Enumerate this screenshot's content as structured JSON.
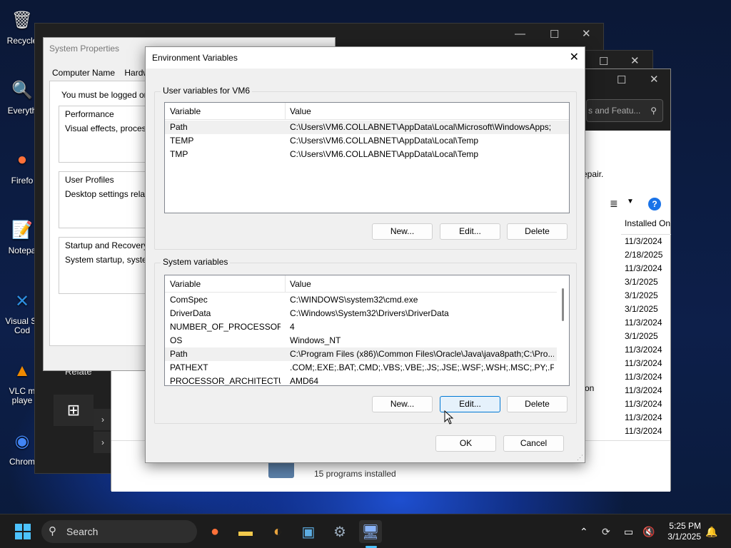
{
  "desktop": {
    "icons": [
      {
        "label": "Recycle",
        "icon": "recycle-bin-icon"
      },
      {
        "label": "Everyth",
        "icon": "search-tool-icon"
      },
      {
        "label": "Firefo",
        "icon": "firefox-icon"
      },
      {
        "label": "Notepa",
        "icon": "notepad-icon"
      },
      {
        "label": "Visual St\nCod",
        "icon": "vscode-icon"
      },
      {
        "label": "VLC m\nplaye",
        "icon": "vlc-icon"
      },
      {
        "label": "Chrom",
        "icon": "chrome-icon"
      }
    ]
  },
  "programs_features": {
    "search_placeholder": "s and Featu...",
    "repair_text": "epair.",
    "installed_on_header": "Installed On",
    "dates": [
      "11/3/2024",
      "2/18/2025",
      "11/3/2024",
      "3/1/2025",
      "3/1/2025",
      "3/1/2025",
      "11/3/2024",
      "3/1/2025",
      "11/3/2024",
      "11/3/2024",
      "11/3/2024",
      "11/3/2024",
      "11/3/2024",
      "11/3/2024",
      "11/3/2024"
    ],
    "on_text": "on",
    "footer_count": "15 programs installed",
    "relate_text": "Relate"
  },
  "system_properties": {
    "title": "System Properties",
    "tab_computer_name": "Computer Name",
    "tab_hardware": "Hardwa",
    "logged_on_text": "You must be logged on a",
    "performance_label": "Performance",
    "performance_text": "Visual effects, processo",
    "user_profiles_label": "User Profiles",
    "user_profiles_text": "Desktop settings related",
    "startup_label": "Startup and Recovery",
    "startup_text": "System startup, system f"
  },
  "env_dialog": {
    "title": "Environment Variables",
    "user_group_label": "User variables for VM6",
    "system_group_label": "System variables",
    "col_variable": "Variable",
    "col_value": "Value",
    "user_vars": [
      {
        "name": "Path",
        "value": "C:\\Users\\VM6.COLLABNET\\AppData\\Local\\Microsoft\\WindowsApps;"
      },
      {
        "name": "TEMP",
        "value": "C:\\Users\\VM6.COLLABNET\\AppData\\Local\\Temp"
      },
      {
        "name": "TMP",
        "value": "C:\\Users\\VM6.COLLABNET\\AppData\\Local\\Temp"
      }
    ],
    "system_vars": [
      {
        "name": "ComSpec",
        "value": "C:\\WINDOWS\\system32\\cmd.exe"
      },
      {
        "name": "DriverData",
        "value": "C:\\Windows\\System32\\Drivers\\DriverData"
      },
      {
        "name": "NUMBER_OF_PROCESSORS",
        "value": "4"
      },
      {
        "name": "OS",
        "value": "Windows_NT"
      },
      {
        "name": "Path",
        "value": "C:\\Program Files (x86)\\Common Files\\Oracle\\Java\\java8path;C:\\Pro..."
      },
      {
        "name": "PATHEXT",
        "value": ".COM;.EXE;.BAT;.CMD;.VBS;.VBE;.JS;.JSE;.WSF;.WSH;.MSC;.PY;.PYW"
      },
      {
        "name": "PROCESSOR_ARCHITECTURE",
        "value": "AMD64"
      }
    ],
    "btn_new": "New...",
    "btn_edit": "Edit...",
    "btn_delete": "Delete",
    "btn_ok": "OK",
    "btn_cancel": "Cancel"
  },
  "taskbar": {
    "search_label": "Search",
    "time": "5:25 PM",
    "date": "3/1/2025",
    "accent": "#0078d4"
  }
}
